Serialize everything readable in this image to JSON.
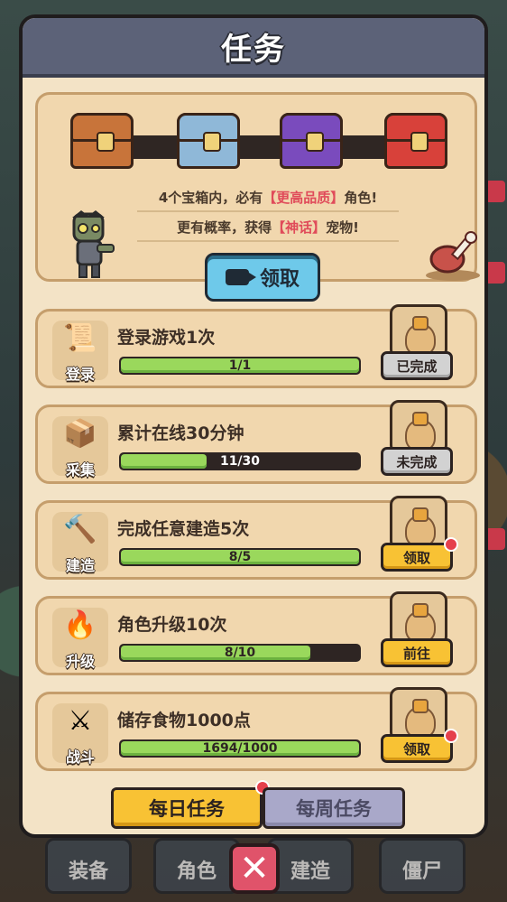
{
  "panel": {
    "title": "任务"
  },
  "reward": {
    "line1_prefix": "4个宝箱内，必有",
    "line1_highlight": "【更高品质】",
    "line1_suffix": "角色!",
    "line2_prefix": "更有概率，获得",
    "line2_highlight": "【神话】",
    "line2_suffix": "宠物!",
    "claim_label": "领取",
    "chests": [
      {
        "name": "wooden-chest-icon",
        "color": "#c8743a"
      },
      {
        "name": "silver-chest-icon",
        "color": "#8fb8d8"
      },
      {
        "name": "purple-chest-icon",
        "color": "#7a4bbd"
      },
      {
        "name": "golden-chest-icon",
        "color": "#d8413a"
      }
    ]
  },
  "tasks": [
    {
      "title": "登录游戏1次",
      "category": "登录",
      "icon": "scroll-icon",
      "progress_text": "1/1",
      "progress": 1.0,
      "button": "已完成",
      "button_style": "done",
      "notify": false
    },
    {
      "title": "累计在线30分钟",
      "category": "采集",
      "icon": "box-icon",
      "progress_text": "11/30",
      "progress": 0.37,
      "button": "未完成",
      "button_style": "done",
      "notify": false
    },
    {
      "title": "完成任意建造5次",
      "category": "建造",
      "icon": "hammer-icon",
      "progress_text": "8/5",
      "progress": 1.0,
      "button": "领取",
      "button_style": "claim",
      "notify": true
    },
    {
      "title": "角色升级10次",
      "category": "升级",
      "icon": "campfire-icon",
      "progress_text": "8/10",
      "progress": 0.8,
      "button": "前往",
      "button_style": "claim",
      "notify": false
    },
    {
      "title": "储存食物1000点",
      "category": "战斗",
      "icon": "crossed-swords-icon",
      "progress_text": "1694/1000",
      "progress": 1.0,
      "button": "领取",
      "button_style": "claim",
      "notify": true
    }
  ],
  "tabs": {
    "daily": "每日任务",
    "weekly": "每周任务"
  },
  "bottom_nav": {
    "equip": "装备",
    "role": "角色",
    "build": "建造",
    "zombie": "僵尸"
  },
  "colors": {
    "accent_yellow": "#f8c234",
    "progress_green": "#9ad85c",
    "notify_red": "#e5404c",
    "header": "#5c6278"
  }
}
